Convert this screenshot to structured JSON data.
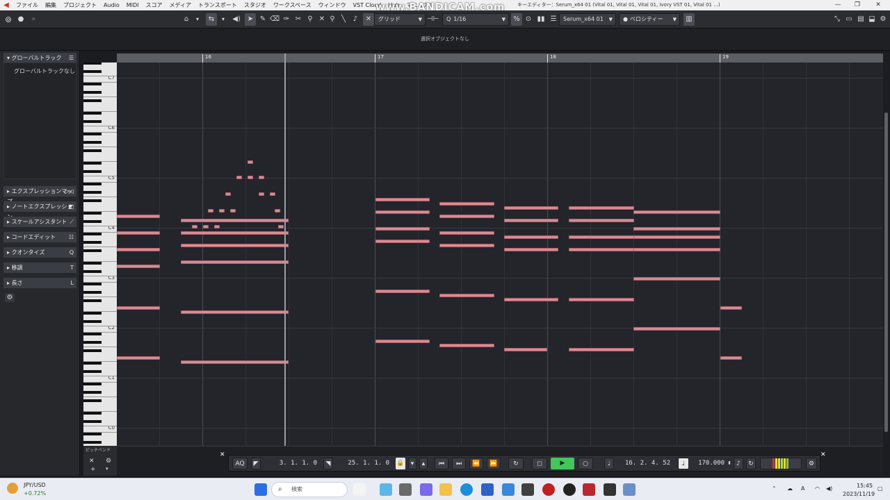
{
  "window": {
    "title": "キーエディター：Serum_x64 01 (Vital 01, Vital 01, Vital 01, Ivory VST 01, Vital 01 ...)",
    "watermark": "www.BANDICAM.com"
  },
  "menu": [
    "ファイル",
    "編集",
    "プロジェクト",
    "Audio",
    "MIDI",
    "スコア",
    "メディア",
    "トランスポート",
    "スタジオ",
    "ワークスペース",
    "ウィンドウ",
    "VST Cloud",
    "Hub",
    "マニュアル"
  ],
  "toolbar": {
    "grid_type": "グリッド",
    "quantize": "1/16",
    "instrument": "Serum_x64 01",
    "lane_mode": "ベロシティー"
  },
  "info_line": {
    "text": "選択オブジェクトなし"
  },
  "left_zone": {
    "global_tracks_header": "グローバルトラック",
    "global_tracks_empty": "グローバルトラックなし",
    "sections": [
      {
        "label": "エクスプレッションマップ",
        "icon": "expression-map-icon"
      },
      {
        "label": "ノートエクスプレッション",
        "icon": "note-expression-icon"
      },
      {
        "label": "スケールアシスタント",
        "icon": "scale-icon"
      },
      {
        "label": "コードエディット",
        "icon": "chord-icon"
      },
      {
        "label": "クオンタイズ",
        "icon": "quantize-icon"
      },
      {
        "label": "移調",
        "icon": "transpose-icon"
      },
      {
        "label": "長さ",
        "icon": "length-icon"
      }
    ]
  },
  "keyboard": {
    "octave_labels": [
      "C7",
      "C6",
      "C5",
      "C4",
      "C3",
      "C2",
      "C1",
      "C0"
    ],
    "footer_label": "ピッチベンド"
  },
  "ruler": {
    "bars": [
      "16",
      "17",
      "18",
      "19"
    ]
  },
  "transport": {
    "aq": "AQ",
    "left_locator": "3. 1. 1.  0",
    "right_locator": "25. 1. 1.  0",
    "position": "16. 2. 4. 52",
    "tempo": "170.000"
  },
  "taskbar": {
    "ticker": "JPY/USD",
    "ticker_change": "+0.72%",
    "search_placeholder": "検索",
    "time": "15:45",
    "date": "2023/11/19"
  },
  "colors": {
    "note": "#d98a93",
    "grid_bg": "#23252b",
    "play": "#43c65c"
  }
}
